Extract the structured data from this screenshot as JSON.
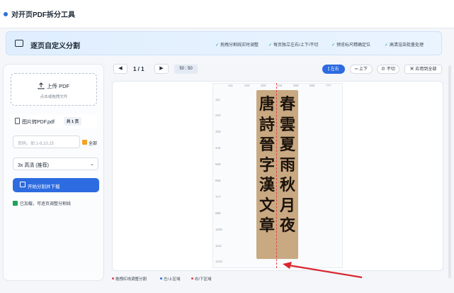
{
  "app_title": "对开页PDF拆分工具",
  "banner": {
    "title": "逐页自定义分割",
    "features": [
      "拖拽分割线实时调整",
      "每页独立左右/上下/不切",
      "预览标尺精确定位",
      "高清渲染批量处理"
    ]
  },
  "upload": {
    "label": "上传 PDF",
    "hint": "点击或拖拽文件"
  },
  "file": {
    "name": "图片转PDF.pdf",
    "pages_badge": "共 1 页"
  },
  "range": {
    "placeholder": "页码，如 1-8,10,15"
  },
  "all_label": "全部",
  "quality": {
    "selected": "3x 高清 (推荐)"
  },
  "start_button": "开始分割并下载",
  "status": "已加载，可逐页调整分割线",
  "toolbar": {
    "prev": "◀",
    "next": "▶",
    "page": "1 / 1",
    "ratio": "50 : 50",
    "mode_lr": "左右",
    "mode_tb": "上下",
    "mode_none": "不切",
    "apply_all": "应用到全部"
  },
  "ruler": {
    "top": [
      "111",
      "222",
      "333",
      "444",
      "555",
      "666",
      "777"
    ],
    "left": [
      "111",
      "222",
      "333",
      "444",
      "555",
      "666",
      "777",
      "888",
      "1000",
      "1111",
      "1222"
    ]
  },
  "calligraphy": {
    "right_column": [
      "春",
      "雲",
      "夏",
      "雨",
      "秋",
      "月",
      "夜"
    ],
    "left_column": [
      "唐",
      "詩",
      "晉",
      "字",
      "漢",
      "文",
      "章"
    ]
  },
  "legend": [
    {
      "label": "拖拽红线调整分割",
      "color": "#e0444b"
    },
    {
      "label": "左/上区域",
      "color": "#2d6be0"
    },
    {
      "label": "右/下区域",
      "color": "#e0444b"
    }
  ],
  "colors": {
    "accent": "#2d6be0",
    "split_line": "#e0444b",
    "success": "#1fa35b"
  }
}
